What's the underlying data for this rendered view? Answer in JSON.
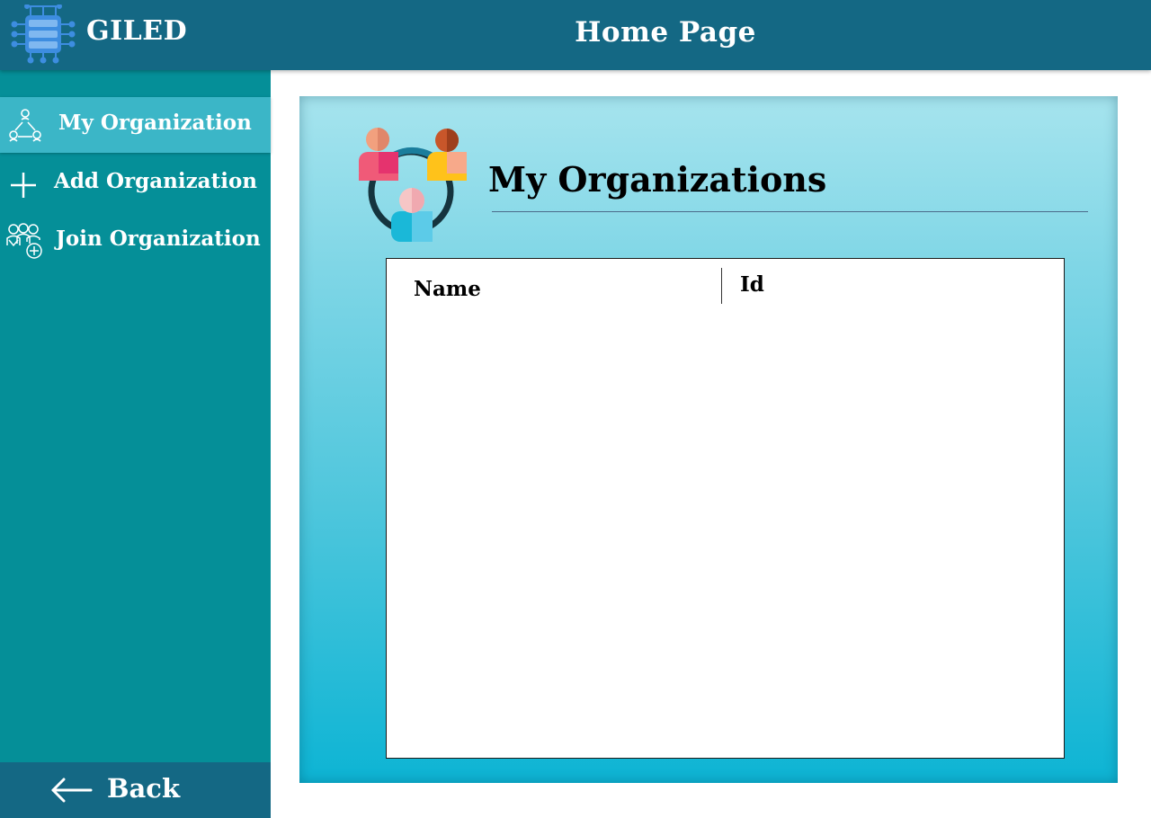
{
  "header": {
    "brand": "GILED",
    "title": "Home Page",
    "logo_icon": "server-network-icon",
    "color": "#146884"
  },
  "sidebar": {
    "color": "#058f98",
    "active_color": "#3bb6c7",
    "items": [
      {
        "label": "My Organization",
        "icon": "network-triangle-icon",
        "active": true
      },
      {
        "label": "Add Organization",
        "icon": "plus-icon",
        "active": false
      },
      {
        "label": "Join Organization",
        "icon": "group-add-icon",
        "active": false
      }
    ],
    "back": {
      "label": "Back",
      "icon": "arrow-left-icon"
    }
  },
  "main": {
    "title": "My Organizations",
    "icon": "people-circle-icon",
    "table": {
      "columns": [
        "Name",
        "Id"
      ],
      "rows": []
    }
  }
}
